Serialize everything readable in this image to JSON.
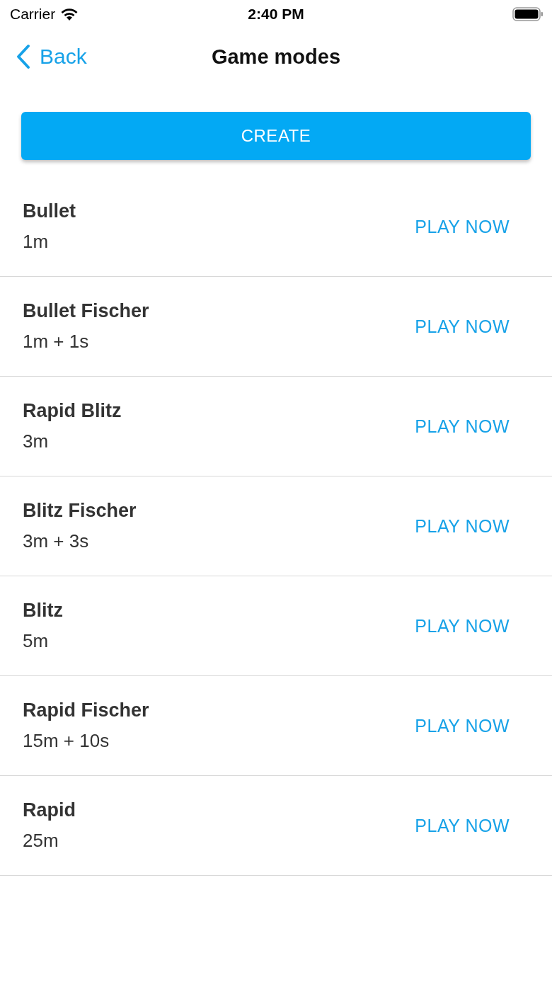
{
  "status_bar": {
    "carrier": "Carrier",
    "time": "2:40 PM"
  },
  "nav": {
    "back": "Back",
    "title": "Game modes"
  },
  "create_button": "CREATE",
  "modes": [
    {
      "name": "Bullet",
      "time": "1m",
      "action": "PLAY NOW"
    },
    {
      "name": "Bullet Fischer",
      "time": "1m + 1s",
      "action": "PLAY NOW"
    },
    {
      "name": "Rapid Blitz",
      "time": "3m",
      "action": "PLAY NOW"
    },
    {
      "name": "Blitz Fischer",
      "time": "3m + 3s",
      "action": "PLAY NOW"
    },
    {
      "name": "Blitz",
      "time": "5m",
      "action": "PLAY NOW"
    },
    {
      "name": "Rapid Fischer",
      "time": "15m + 10s",
      "action": "PLAY NOW"
    },
    {
      "name": "Rapid",
      "time": "25m",
      "action": "PLAY NOW"
    }
  ]
}
